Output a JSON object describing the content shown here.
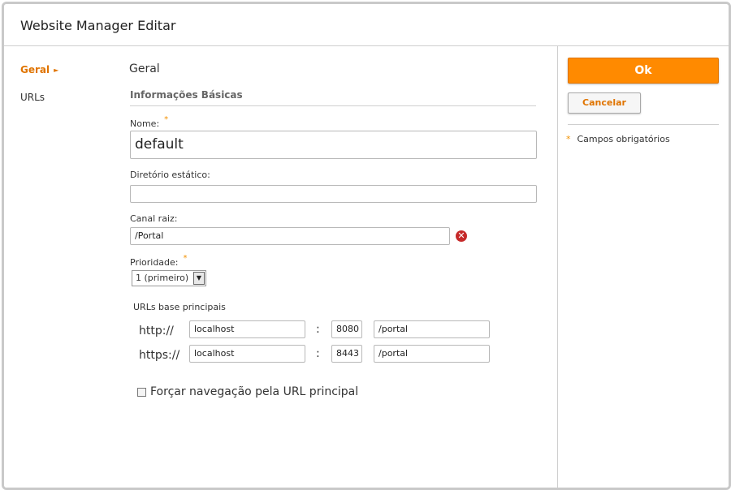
{
  "window": {
    "title": "Website Manager Editar"
  },
  "nav": {
    "items": [
      {
        "label": "Geral",
        "active": true
      },
      {
        "label": "URLs",
        "active": false
      }
    ]
  },
  "form": {
    "panel_title": "Geral",
    "section_title": "Informações Básicas",
    "nome_label": "Nome:",
    "nome_value": "default",
    "diretorio_label": "Diretório estático:",
    "diretorio_value": "",
    "canal_label": "Canal raiz:",
    "canal_value": "/Portal",
    "prioridade_label": "Prioridade:",
    "prioridade_value": "1 (primeiro)",
    "required_mark": "*",
    "urls_title": "URLs base principais",
    "urls": [
      {
        "protocol": "http://",
        "host": "localhost",
        "port": "8080",
        "path": "/portal"
      },
      {
        "protocol": "https://",
        "host": "localhost",
        "port": "8443",
        "path": "/portal"
      }
    ],
    "colon": ":",
    "force_nav_label": "Forçar navegação pela URL principal",
    "force_nav_checked": false
  },
  "actions": {
    "ok_label": "Ok",
    "cancel_label": "Cancelar",
    "required_note": "Campos obrigatórios",
    "required_star": "*"
  },
  "colors": {
    "accent": "#ff8a00",
    "accent_text": "#e07400",
    "error": "#c62a2a"
  },
  "icons": {
    "remove": "close-circle-icon",
    "nav_arrow": "triangle-right-icon",
    "dropdown": "chevron-down-icon"
  }
}
